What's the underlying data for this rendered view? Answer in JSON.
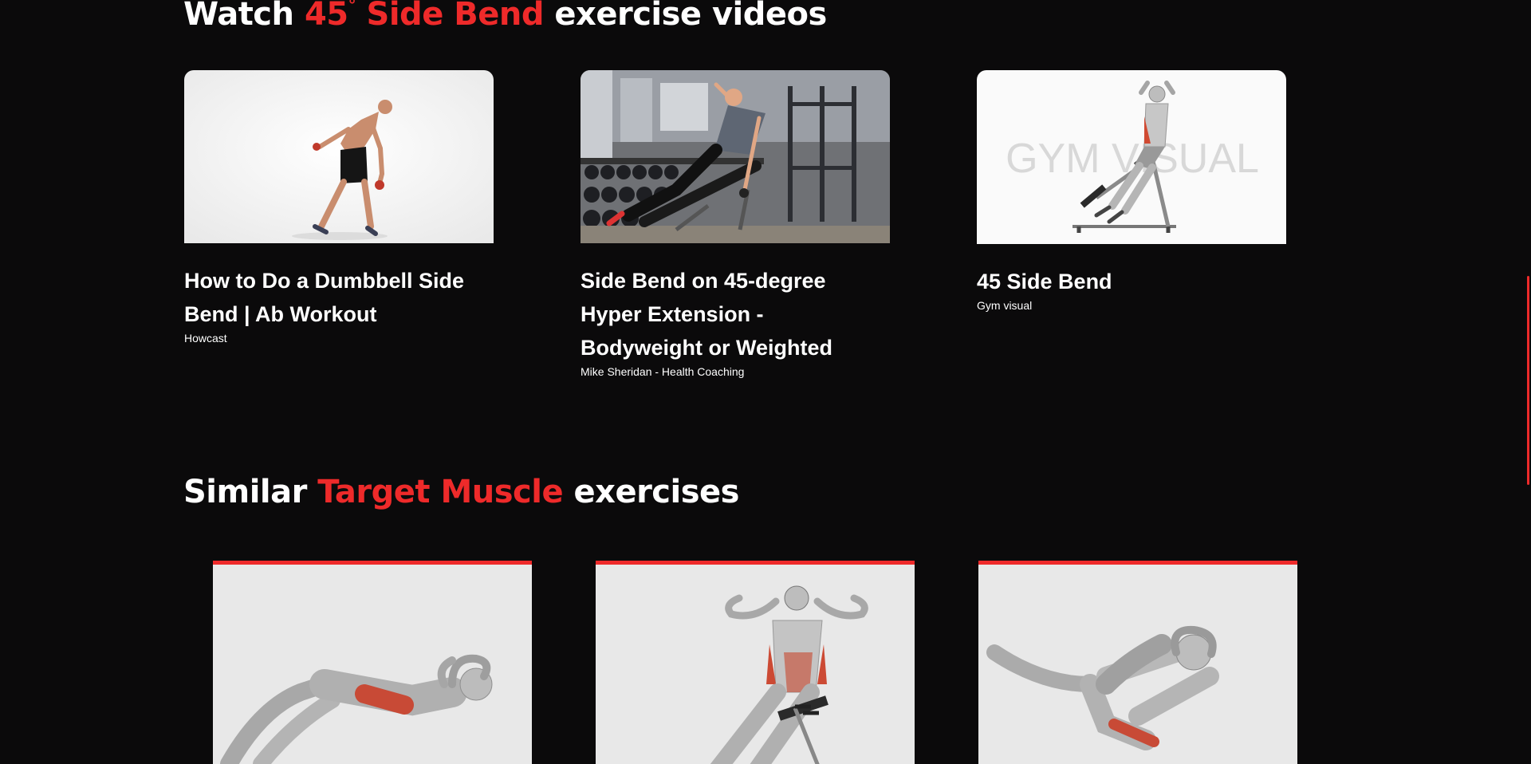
{
  "videos_section": {
    "title_prefix": "Watch",
    "title_accent_main": "45",
    "title_accent_degree": "°",
    "title_accent_rest": " Side Bend",
    "title_suffix": "exercise videos",
    "videos": [
      {
        "title": "How to Do a Dumbbell Side Bend | Ab Workout",
        "channel": "Howcast",
        "thumbnail_icon": "dumbbell-side-bend-thumbnail"
      },
      {
        "title": "Side Bend on 45-degree Hyper Extension - Bodyweight or Weighted",
        "channel": "Mike Sheridan - Health Coaching",
        "thumbnail_icon": "hyperextension-gym-thumbnail"
      },
      {
        "title": "45 Side Bend",
        "channel": "Gym visual",
        "thumbnail_icon": "gym-visual-thumbnail",
        "watermark": "GYM VISUAL"
      }
    ]
  },
  "similar_section": {
    "title_prefix": "Similar",
    "title_accent": "Target Muscle",
    "title_suffix": "exercises",
    "exercises": [
      {
        "image_icon": "lying-crunch-illustration"
      },
      {
        "image_icon": "incline-bench-twist-illustration"
      },
      {
        "image_icon": "bicycle-crunch-illustration"
      }
    ]
  },
  "colors": {
    "background": "#0b0a0b",
    "accent": "#ee2a2a",
    "text": "#ffffff",
    "card_background": "#e8e8e8"
  }
}
